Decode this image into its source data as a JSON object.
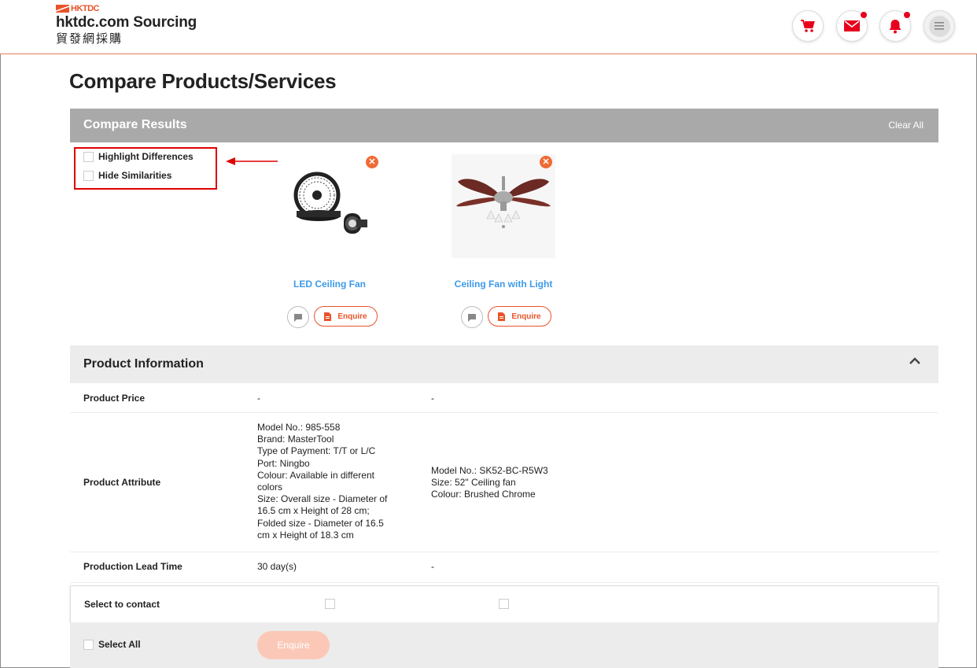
{
  "header": {
    "logo_mark": "HKTDC",
    "logo_line1": "hktdc.com Sourcing",
    "logo_line2": "貿發網採購",
    "icons": [
      "cart-icon",
      "mail-icon",
      "bell-icon",
      "menu-icon"
    ]
  },
  "page_title": "Compare Products/Services",
  "results_bar": {
    "title": "Compare Results",
    "clear_all": "Clear All"
  },
  "options": {
    "highlight": "Highlight Differences",
    "hide": "Hide Similarities"
  },
  "products": [
    {
      "name": "LED Ceiling Fan",
      "enquire": "Enquire"
    },
    {
      "name": "Ceiling Fan with Light",
      "enquire": "Enquire"
    }
  ],
  "product_info": {
    "title": "Product Information",
    "rows": [
      {
        "label": "Product Price",
        "values": [
          "-",
          "-"
        ]
      },
      {
        "label": "Product Attribute",
        "values": [
          [
            "Model No.: 985-558",
            "Brand: MasterTool",
            "Type of Payment: T/T or L/C",
            "Port: Ningbo",
            "Colour: Available in different colors",
            "Size: Overall size - Diameter of 16.5 cm x Height of 28 cm; Folded size - Diameter of 16.5 cm x Height of 18.3 cm"
          ],
          [
            "Model No.: SK52-BC-R5W3",
            "Size: 52\" Ceiling fan",
            "Colour: Brushed Chrome"
          ]
        ]
      },
      {
        "label": "Production Lead Time",
        "values": [
          "30 day(s)",
          "-"
        ]
      }
    ]
  },
  "contact": {
    "label": "Select to contact"
  },
  "footer": {
    "select_all": "Select All",
    "enquire": "Enquire"
  },
  "colors": {
    "accent": "#e8542a",
    "link": "#3d9ae8",
    "bar_grey": "#a9a9a9",
    "highlight_box": "#e00000"
  }
}
